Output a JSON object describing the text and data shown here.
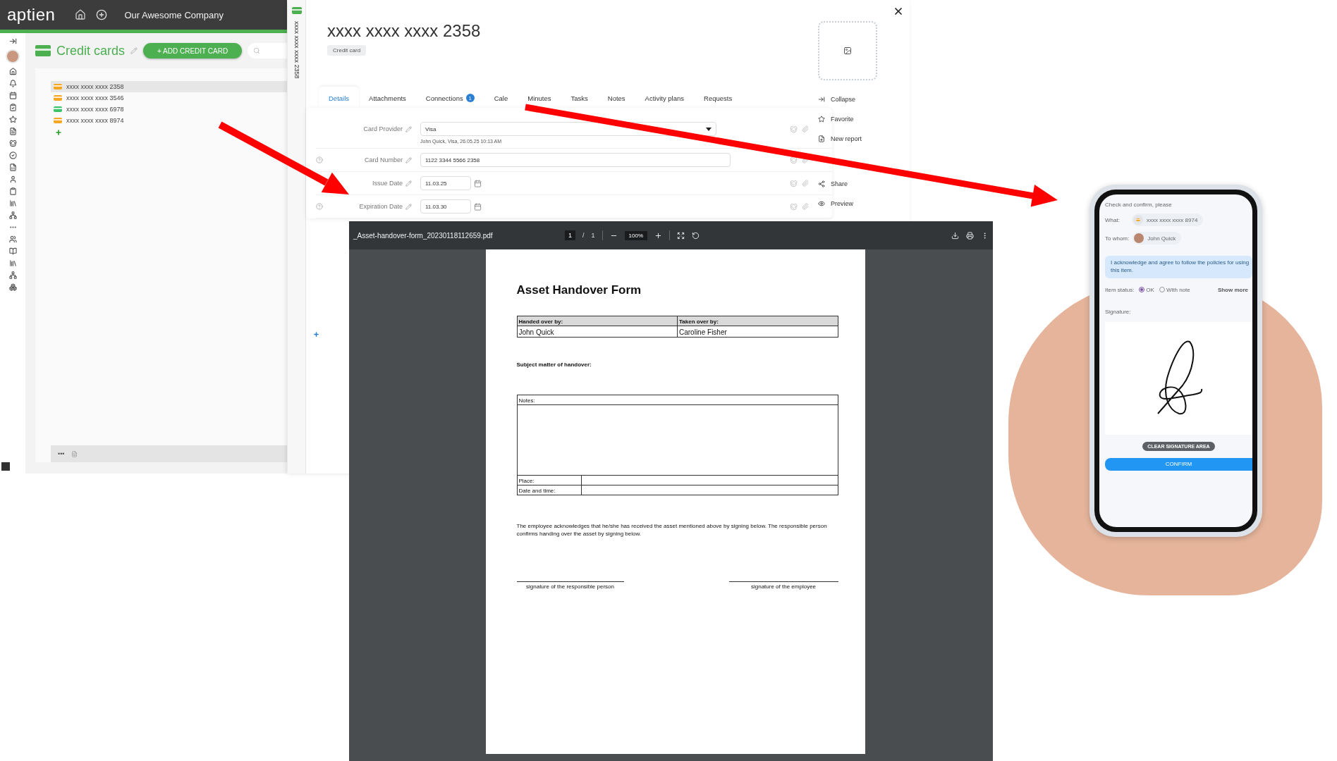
{
  "app": {
    "logo": "aptien",
    "company": "Our Awesome Company",
    "title": "Credit cards",
    "add_button": "+ ADD CREDIT CARD",
    "cards": [
      {
        "label": "xxxx xxxx xxxx 2358",
        "color": "#f5a623",
        "selected": true
      },
      {
        "label": "xxxx xxxx xxxx 3546",
        "color": "#f5a623",
        "selected": false
      },
      {
        "label": "xxxx xxxx xxxx 6978",
        "color": "#3cc46a",
        "selected": false
      },
      {
        "label": "xxxx xxxx xxxx 8974",
        "color": "#f5a623",
        "selected": false
      }
    ],
    "footer_more": "•••"
  },
  "detail": {
    "side_label": "xxxx xxxx xxxx 2358",
    "title": "xxxx xxxx xxxx 2358",
    "badge": "Credit card",
    "tabs": [
      {
        "label": "Details",
        "selected": true
      },
      {
        "label": "Attachments",
        "selected": false
      },
      {
        "label": "Connections",
        "count": "1",
        "selected": false
      },
      {
        "label": "Cale",
        "selected": false
      },
      {
        "label": "Minutes",
        "selected": false
      },
      {
        "label": "Tasks",
        "selected": false
      },
      {
        "label": "Notes",
        "selected": false
      },
      {
        "label": "Activity plans",
        "selected": false
      },
      {
        "label": "Requests",
        "selected": false
      }
    ],
    "fields": [
      {
        "kind": "select",
        "label": "Card Provider",
        "value": "Visa",
        "meta": "John Quick, Visa, 26.05.25 10:13 AM",
        "help": false
      },
      {
        "kind": "text",
        "label": "Card Number",
        "value": "1122 3344 5566  2358",
        "help": true
      },
      {
        "kind": "date",
        "label": "Issue Date",
        "value": "11.03.25",
        "help": false
      },
      {
        "kind": "date",
        "label": "Expiration Date",
        "value": "11.03.30",
        "help": true
      }
    ],
    "menu": [
      {
        "kind": "collapse",
        "label": "Collapse"
      },
      {
        "kind": "favorite",
        "label": "Favorite"
      },
      {
        "kind": "report",
        "label": "New report"
      },
      {
        "kind": "share",
        "label": "Share"
      },
      {
        "kind": "preview",
        "label": "Preview"
      }
    ]
  },
  "pdf": {
    "filename": "_Asset-handover-form_20230118112659.pdf",
    "page": "1",
    "separator": "/",
    "pages": "1",
    "zoom": "100%",
    "title": "Asset Handover Form",
    "handed_label": "Handed over by:",
    "handed_value": "John Quick",
    "taken_label": "Taken over by:",
    "taken_value": "Caroline Fisher",
    "subject": "Subject matter of handover:",
    "notes": "Notes:",
    "place": "Place:",
    "datetime": "Date and time:",
    "statement": "The employee acknowledges that he/she has received the asset mentioned above by signing below. The responsible person confirms handing over the asset by signing below.",
    "signatures": [
      "signature of the responsible person",
      "signature of the employee"
    ]
  },
  "phone": {
    "heading": "Check and confirm, please",
    "what_label": "What:",
    "what_value": "xxxx xxxx xxxx 8974",
    "whom_label": "To whom:",
    "whom_value": "John Quick",
    "notice": "I acknowledge and agree to follow the policies for using this item.",
    "status_label": "Item status:",
    "statuses": [
      {
        "label": "OK",
        "selected": true
      },
      {
        "label": "With note",
        "selected": false
      }
    ],
    "show_more": "Show more",
    "signature_label": "Signature:",
    "clear": "CLEAR SIGNATURE AREA",
    "confirm": "CONFIRM"
  }
}
